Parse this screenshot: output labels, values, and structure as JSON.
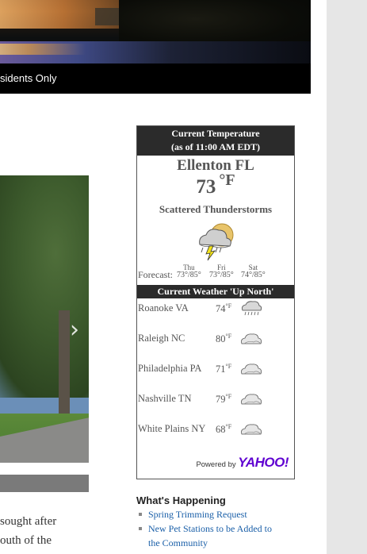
{
  "banner": {
    "caption": "sidents Only"
  },
  "weather": {
    "header_line1": "Current Temperature",
    "header_line2": "(as of 11:00 AM EDT)",
    "city": "Ellenton FL",
    "temperature": "73",
    "unit": "°F",
    "condition": "Scattered Thunderstorms",
    "forecast_label": "Forecast:",
    "forecast": [
      {
        "day": "Thu",
        "range": "73°/85°"
      },
      {
        "day": "Fri",
        "range": "73°/85°"
      },
      {
        "day": "Sat",
        "range": "74°/85°"
      }
    ],
    "north_header": "Current Weather 'Up North'",
    "north": [
      {
        "city": "Roanoke VA",
        "temp": "74",
        "unit": "°F",
        "icon": "rain-cloud-icon"
      },
      {
        "city": "Raleigh NC",
        "temp": "80",
        "unit": "°F",
        "icon": "cloud-icon"
      },
      {
        "city": "Philadelphia PA",
        "temp": "71",
        "unit": "°F",
        "icon": "cloud-icon"
      },
      {
        "city": "Nashville TN",
        "temp": "79",
        "unit": "°F",
        "icon": "cloud-icon"
      },
      {
        "city": "White Plains NY",
        "temp": "68",
        "unit": "°F",
        "icon": "cloud-icon"
      }
    ],
    "powered_by": "Powered by",
    "yahoo": "YAHOO!",
    "colors": {
      "header_bg": "#2b2b2b",
      "yahoo_purple": "#5f01d1"
    }
  },
  "happening": {
    "title": "What's Happening",
    "items": [
      {
        "line1": "Spring Trimming Request",
        "line2": ""
      },
      {
        "line1": "New Pet Stations to be Added to",
        "line2": "the Community"
      }
    ],
    "link_color": "#1a5fa8"
  },
  "article": {
    "line1": "sought after",
    "line2": "outh of the"
  }
}
